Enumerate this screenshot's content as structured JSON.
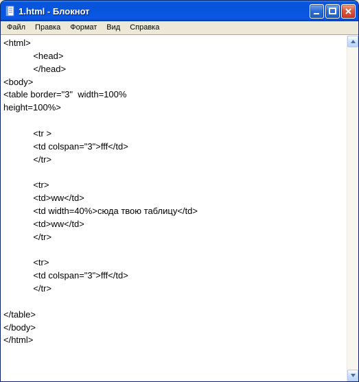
{
  "window": {
    "title": "1.html - Блокнот"
  },
  "menubar": {
    "items": [
      {
        "label": "Файл"
      },
      {
        "label": "Правка"
      },
      {
        "label": "Формат"
      },
      {
        "label": "Вид"
      },
      {
        "label": "Справка"
      }
    ]
  },
  "editor": {
    "content": "<html>\n            <head>\n            </head>\n<body>\n<table border=\"3\"  width=100%\nheight=100%>\n\n            <tr >\n            <td colspan=\"3\">fff</td>\n            </tr>\n\n            <tr>\n            <td>ww</td>\n            <td width=40%>сюда твою таблицу</td>\n            <td>ww</td>\n            </tr>\n\n            <tr>\n            <td colspan=\"3\">fff</td>\n            </tr>\n\n</table>\n</body>\n</html>"
  }
}
